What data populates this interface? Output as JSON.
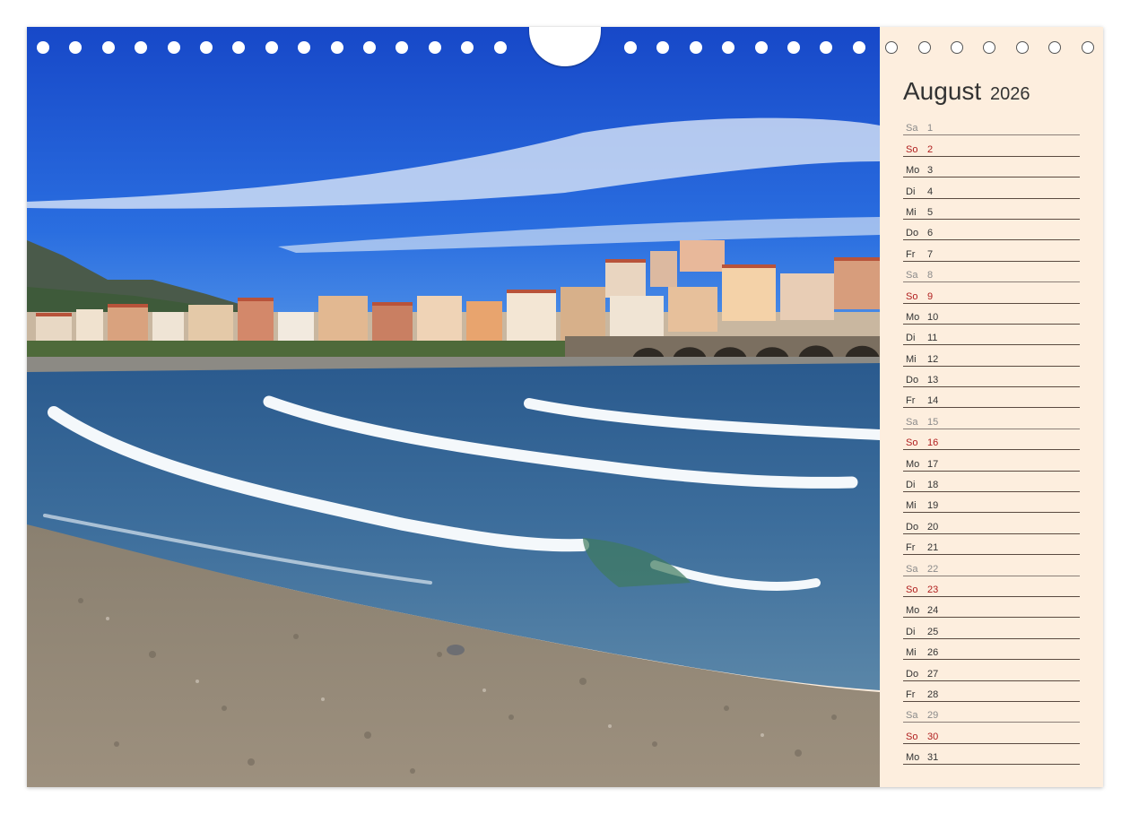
{
  "calendar": {
    "month": "August",
    "year": "2026",
    "days": [
      {
        "wd": "Sa",
        "d": "1",
        "type": "sat"
      },
      {
        "wd": "So",
        "d": "2",
        "type": "sun"
      },
      {
        "wd": "Mo",
        "d": "3",
        "type": "work"
      },
      {
        "wd": "Di",
        "d": "4",
        "type": "work"
      },
      {
        "wd": "Mi",
        "d": "5",
        "type": "work"
      },
      {
        "wd": "Do",
        "d": "6",
        "type": "work"
      },
      {
        "wd": "Fr",
        "d": "7",
        "type": "work"
      },
      {
        "wd": "Sa",
        "d": "8",
        "type": "sat"
      },
      {
        "wd": "So",
        "d": "9",
        "type": "sun"
      },
      {
        "wd": "Mo",
        "d": "10",
        "type": "work"
      },
      {
        "wd": "Di",
        "d": "11",
        "type": "work"
      },
      {
        "wd": "Mi",
        "d": "12",
        "type": "work"
      },
      {
        "wd": "Do",
        "d": "13",
        "type": "work"
      },
      {
        "wd": "Fr",
        "d": "14",
        "type": "work"
      },
      {
        "wd": "Sa",
        "d": "15",
        "type": "sat"
      },
      {
        "wd": "So",
        "d": "16",
        "type": "sun"
      },
      {
        "wd": "Mo",
        "d": "17",
        "type": "work"
      },
      {
        "wd": "Di",
        "d": "18",
        "type": "work"
      },
      {
        "wd": "Mi",
        "d": "19",
        "type": "work"
      },
      {
        "wd": "Do",
        "d": "20",
        "type": "work"
      },
      {
        "wd": "Fr",
        "d": "21",
        "type": "work"
      },
      {
        "wd": "Sa",
        "d": "22",
        "type": "sat"
      },
      {
        "wd": "So",
        "d": "23",
        "type": "sun"
      },
      {
        "wd": "Mo",
        "d": "24",
        "type": "work"
      },
      {
        "wd": "Di",
        "d": "25",
        "type": "work"
      },
      {
        "wd": "Mi",
        "d": "26",
        "type": "work"
      },
      {
        "wd": "Do",
        "d": "27",
        "type": "work"
      },
      {
        "wd": "Fr",
        "d": "28",
        "type": "work"
      },
      {
        "wd": "Sa",
        "d": "29",
        "type": "sat"
      },
      {
        "wd": "So",
        "d": "30",
        "type": "sun"
      },
      {
        "wd": "Mo",
        "d": "31",
        "type": "work"
      }
    ]
  },
  "colors": {
    "sidebar_bg": "#fdeede",
    "sunday": "#b01e1e",
    "saturday": "#8a8a8a",
    "sky": "#1f5fd8",
    "sea": "#2c5f95"
  },
  "photo": {
    "subject": "coastal-town-beach-photo"
  }
}
